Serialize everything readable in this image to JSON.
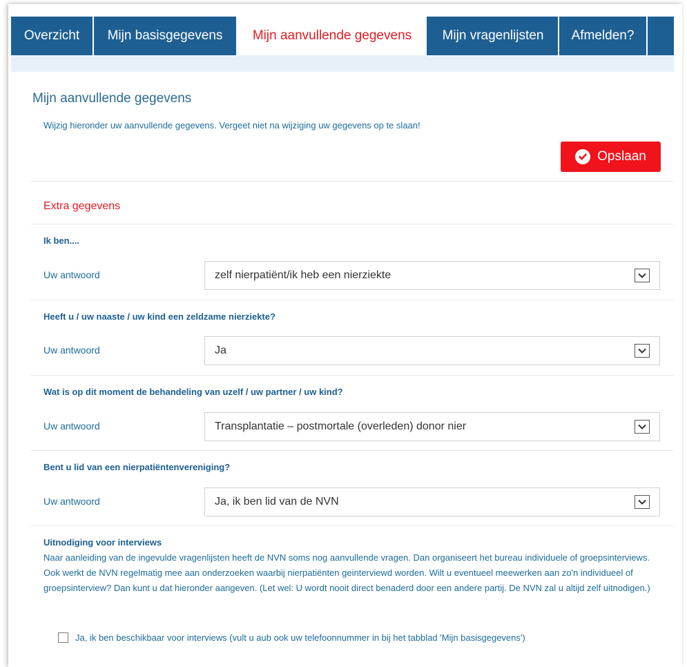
{
  "tabs": [
    {
      "label": "Overzicht",
      "active": false
    },
    {
      "label": "Mijn basisgegevens",
      "active": false
    },
    {
      "label": "Mijn aanvullende gegevens",
      "active": true
    },
    {
      "label": "Mijn vragenlijsten",
      "active": false
    },
    {
      "label": "Afmelden?",
      "active": false
    },
    {
      "label": "",
      "active": false
    }
  ],
  "page": {
    "title": "Mijn aanvullende gegevens",
    "intro": "Wijzig hieronder uw aanvullende gegevens. Vergeet niet na wijziging uw gegevens op te slaan!",
    "save_label": "Opslaan",
    "section_title": "Extra gegevens"
  },
  "questions": [
    {
      "question": "Ik ben....",
      "answer_label": "Uw antwoord",
      "value": "zelf nierpatiënt/ik heb een nierziekte"
    },
    {
      "question": "Heeft u / uw naaste / uw kind een zeldzame nierziekte?",
      "answer_label": "Uw antwoord",
      "value": "Ja"
    },
    {
      "question": "Wat is op dit moment de behandeling van uzelf / uw partner / uw kind?",
      "answer_label": "Uw antwoord",
      "value": "Transplantatie – postmortale (overleden) donor nier"
    },
    {
      "question": "Bent u lid van een nierpatiëntenvereniging?",
      "answer_label": "Uw antwoord",
      "value": "Ja, ik ben lid van de NVN"
    }
  ],
  "interviews": {
    "title": "Uitnodiging voor interviews",
    "text": "Naar aanleiding van de ingevulde vragenlijsten heeft de NVN soms nog aanvullende vragen. Dan organiseert het bureau individuele of groepsinterviews. Ook werkt de NVN regelmatig mee aan onderzoeken waarbij nierpatiënten geinterviewd worden. Wilt u eventueel meewerken aan zo'n individueel of groepsinterview? Dan kunt u dat hieronder aangeven. (Let wel: U wordt nooit direct benaderd door een andere partij. De NVN zal u altijd zelf uitnodigen.)",
    "checkbox_label": "Ja, ik ben beschikbaar voor interviews (vult u aub ook uw telefoonnummer in bij het tabblad 'Mijn basisgegevens')",
    "checked": false
  },
  "colors": {
    "tab_bar": "#1d5f93",
    "accent_red": "#e31b23",
    "button_red": "#f0131c",
    "text_blue": "#1d6c9a"
  }
}
